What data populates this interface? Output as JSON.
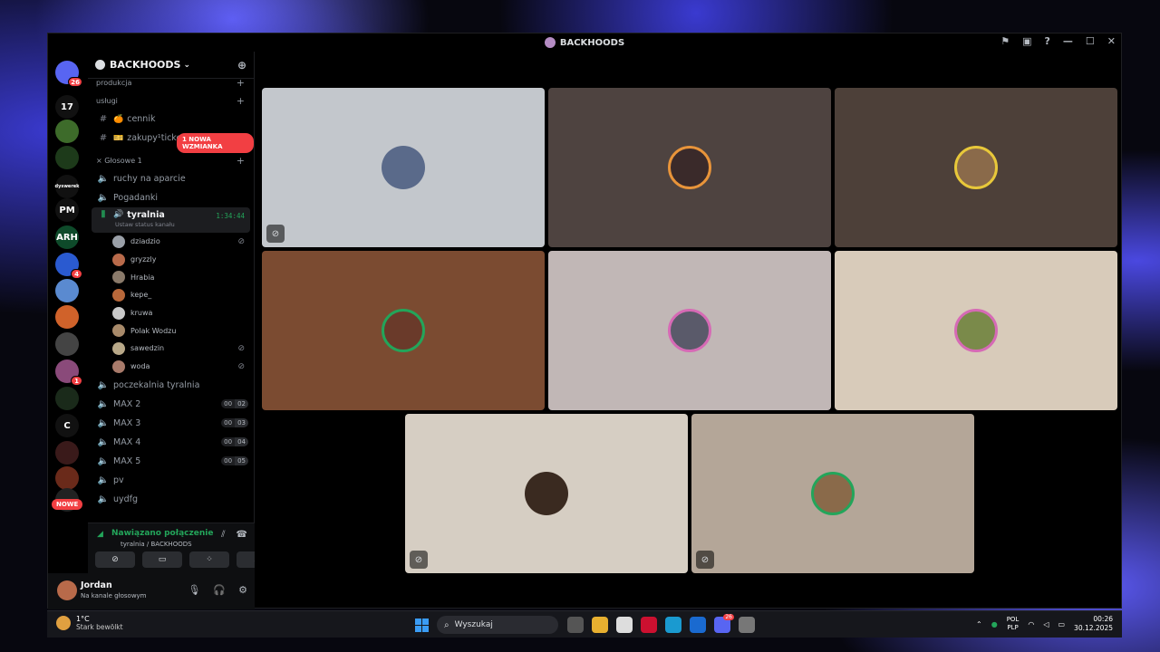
{
  "window": {
    "title": "BACKHOODS",
    "actions": [
      "⚑",
      "▣",
      "?",
      "—",
      "☐",
      "✕"
    ]
  },
  "guilds": {
    "home_badge": "26",
    "items": [
      {
        "label": "",
        "color": "#5865f2",
        "badge": "26"
      },
      {
        "label": "17",
        "color": "#111",
        "badge": ""
      },
      {
        "label": "",
        "color": "#3d6b2a",
        "badge": ""
      },
      {
        "label": "",
        "color": "#1d3a1a",
        "badge": ""
      },
      {
        "label": "dyswerek",
        "color": "#111",
        "badge": ""
      },
      {
        "label": "PM",
        "color": "#111",
        "badge": ""
      },
      {
        "label": "ARH",
        "color": "#0e4a2a",
        "badge": ""
      },
      {
        "label": "",
        "color": "#2a5ad0",
        "badge": "4"
      },
      {
        "label": "",
        "color": "#5a8ad0",
        "badge": ""
      },
      {
        "label": "",
        "color": "#d0622a",
        "badge": ""
      },
      {
        "label": "",
        "color": "#444",
        "badge": ""
      },
      {
        "label": "",
        "color": "#8a4a7a",
        "badge": "1"
      },
      {
        "label": "",
        "color": "#1a2a1a",
        "badge": ""
      },
      {
        "label": "C",
        "color": "#111",
        "badge": ""
      },
      {
        "label": "",
        "color": "#3a1a1a",
        "badge": ""
      },
      {
        "label": "",
        "color": "#6a2a1a",
        "badge": ""
      },
      {
        "label": "",
        "color": "#222",
        "badge": ""
      }
    ],
    "new_label": "NOWE"
  },
  "server": {
    "name": "BACKHOODS",
    "mention_pill": "1 NOWA WZMIANKA"
  },
  "sidebar": {
    "cat_produkcja": "produkcja",
    "cat_uslugi": "usługi",
    "text_channels": [
      {
        "icon": "🍊",
        "name": "cennik"
      },
      {
        "icon": "🎫",
        "name": "zakupy¹ticket"
      }
    ],
    "cat_voice": "× Głosowe 1",
    "voice_top": [
      {
        "name": "ruchy na aparcie",
        "prefix": ""
      },
      {
        "name": "Pogadanki",
        "prefix": "• "
      }
    ],
    "active_channel": {
      "name": "tyralnia",
      "timer": "1:34:44",
      "status_hint": "Ustaw status kanału"
    },
    "members": [
      {
        "name": "dziadzio",
        "muted": true,
        "color": "#9aa0a8"
      },
      {
        "name": "gryzzly",
        "muted": false,
        "color": "#b86a4a"
      },
      {
        "name": "Hrabia",
        "muted": false,
        "color": "#8a7a6a"
      },
      {
        "name": "kepe_",
        "muted": false,
        "color": "#b8683a"
      },
      {
        "name": "kruwa",
        "muted": false,
        "color": "#c8c8c8"
      },
      {
        "name": "Polak Wodzu",
        "muted": false,
        "color": "#a88a6a"
      },
      {
        "name": "sawedzin",
        "muted": true,
        "color": "#b8a888"
      },
      {
        "name": "woda",
        "muted": true,
        "color": "#a87a6a"
      }
    ],
    "voice_bottom": [
      {
        "name": "poczekalnia tyralnia",
        "c1": "",
        "c2": ""
      },
      {
        "name": "MAX 2",
        "c1": "00",
        "c2": "02"
      },
      {
        "name": "MAX 3",
        "c1": "00",
        "c2": "03"
      },
      {
        "name": "MAX 4",
        "c1": "00",
        "c2": "04"
      },
      {
        "name": "MAX 5",
        "c1": "00",
        "c2": "05"
      },
      {
        "name": "pv",
        "c1": "",
        "c2": ""
      },
      {
        "name": "uydfg",
        "c1": "",
        "c2": ""
      }
    ]
  },
  "voice_panel": {
    "status": "Nawiązano połączenie",
    "location": "tyralnia / BACKHOODS"
  },
  "user": {
    "name": "Jordan",
    "status": "Na kanale głosowym"
  },
  "tiles": [
    {
      "bg": "#c3c7cc",
      "avatar_color": "#5a6a8a",
      "ring": "",
      "muted": true
    },
    {
      "bg": "#4e4340",
      "avatar_color": "#3a2a2a",
      "ring": "ring-orange",
      "muted": false
    },
    {
      "bg": "#4d4039",
      "avatar_color": "#8a6a4a",
      "ring": "ring-yellow",
      "muted": false
    },
    {
      "bg": "#7b4b31",
      "avatar_color": "#6a3a2a",
      "ring": "speaking",
      "muted": false
    },
    {
      "bg": "#c1b7b6",
      "avatar_color": "#5a5a6a",
      "ring": "ring-pink",
      "muted": false
    },
    {
      "bg": "#d8cbba",
      "avatar_color": "#7a8a4a",
      "ring": "ring-pink",
      "muted": false
    },
    {
      "bg": "#d6cec3",
      "avatar_color": "#3a2a20",
      "ring": "",
      "muted": true
    },
    {
      "bg": "#b4a698",
      "avatar_color": "#8a6a4a",
      "ring": "speaking",
      "muted": true
    }
  ],
  "taskbar": {
    "temp": "1°C",
    "weather_desc": "Stark bewölkt",
    "search_placeholder": "Wyszukaj",
    "apps": [
      {
        "name": "task-view",
        "color": "#555",
        "badge": ""
      },
      {
        "name": "explorer",
        "color": "#e8b030",
        "badge": ""
      },
      {
        "name": "store",
        "color": "#ddd",
        "badge": ""
      },
      {
        "name": "opera",
        "color": "#cc1030",
        "badge": ""
      },
      {
        "name": "edge",
        "color": "#1a9ad0",
        "badge": ""
      },
      {
        "name": "outlook",
        "color": "#1a6ad0",
        "badge": ""
      },
      {
        "name": "discord",
        "color": "#5865f2",
        "badge": "26"
      },
      {
        "name": "other",
        "color": "#777",
        "badge": ""
      }
    ],
    "lang_top": "POL",
    "lang_bottom": "PLP",
    "time": "00:26",
    "date": "30.12.2025"
  }
}
